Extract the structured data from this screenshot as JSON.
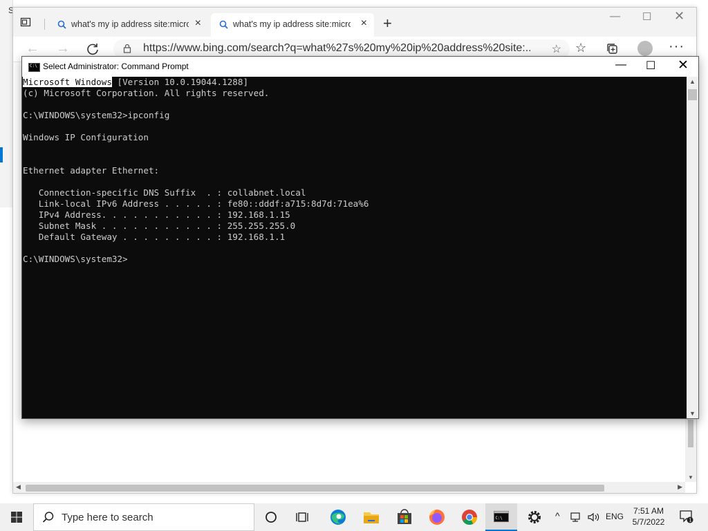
{
  "desktop": {
    "edge_char": "S"
  },
  "browser": {
    "tabs": [
      {
        "label": "what's my ip address site:microsoft.com",
        "active": false
      },
      {
        "label": "what's my ip address site:microsoft.com",
        "active": true
      }
    ],
    "url": "https://www.bing.com/search?q=what%27s%20my%20ip%20address%20site:..."
  },
  "cmd": {
    "title": "Select Administrator: Command Prompt",
    "lines": [
      {
        "pre": "",
        "sel": "Microsoft Windows",
        "post": " [Version 10.0.19044.1288]"
      },
      {
        "pre": "(c) Microsoft Corporation. All rights reserved.",
        "sel": "",
        "post": ""
      },
      {
        "pre": "",
        "sel": "",
        "post": ""
      },
      {
        "pre": "C:\\WINDOWS\\system32>ipconfig",
        "sel": "",
        "post": ""
      },
      {
        "pre": "",
        "sel": "",
        "post": ""
      },
      {
        "pre": "Windows IP Configuration",
        "sel": "",
        "post": ""
      },
      {
        "pre": "",
        "sel": "",
        "post": ""
      },
      {
        "pre": "",
        "sel": "",
        "post": ""
      },
      {
        "pre": "Ethernet adapter Ethernet:",
        "sel": "",
        "post": ""
      },
      {
        "pre": "",
        "sel": "",
        "post": ""
      },
      {
        "pre": "   Connection-specific DNS Suffix  . : collabnet.local",
        "sel": "",
        "post": ""
      },
      {
        "pre": "   Link-local IPv6 Address . . . . . : fe80::dddf:a715:8d7d:71ea%6",
        "sel": "",
        "post": ""
      },
      {
        "pre": "   IPv4 Address. . . . . . . . . . . : 192.168.1.15",
        "sel": "",
        "post": ""
      },
      {
        "pre": "   Subnet Mask . . . . . . . . . . . : 255.255.255.0",
        "sel": "",
        "post": ""
      },
      {
        "pre": "   Default Gateway . . . . . . . . . : 192.168.1.1",
        "sel": "",
        "post": ""
      },
      {
        "pre": "",
        "sel": "",
        "post": ""
      },
      {
        "pre": "C:\\WINDOWS\\system32>",
        "sel": "",
        "post": ""
      }
    ]
  },
  "taskbar": {
    "search_placeholder": "Type here to search",
    "language": "ENG",
    "time": "7:51 AM",
    "date": "5/7/2022",
    "notification_count": "1"
  },
  "colors": {
    "console_bg": "#0c0c0c",
    "console_fg": "#cccccc",
    "accent": "#0078d4"
  }
}
